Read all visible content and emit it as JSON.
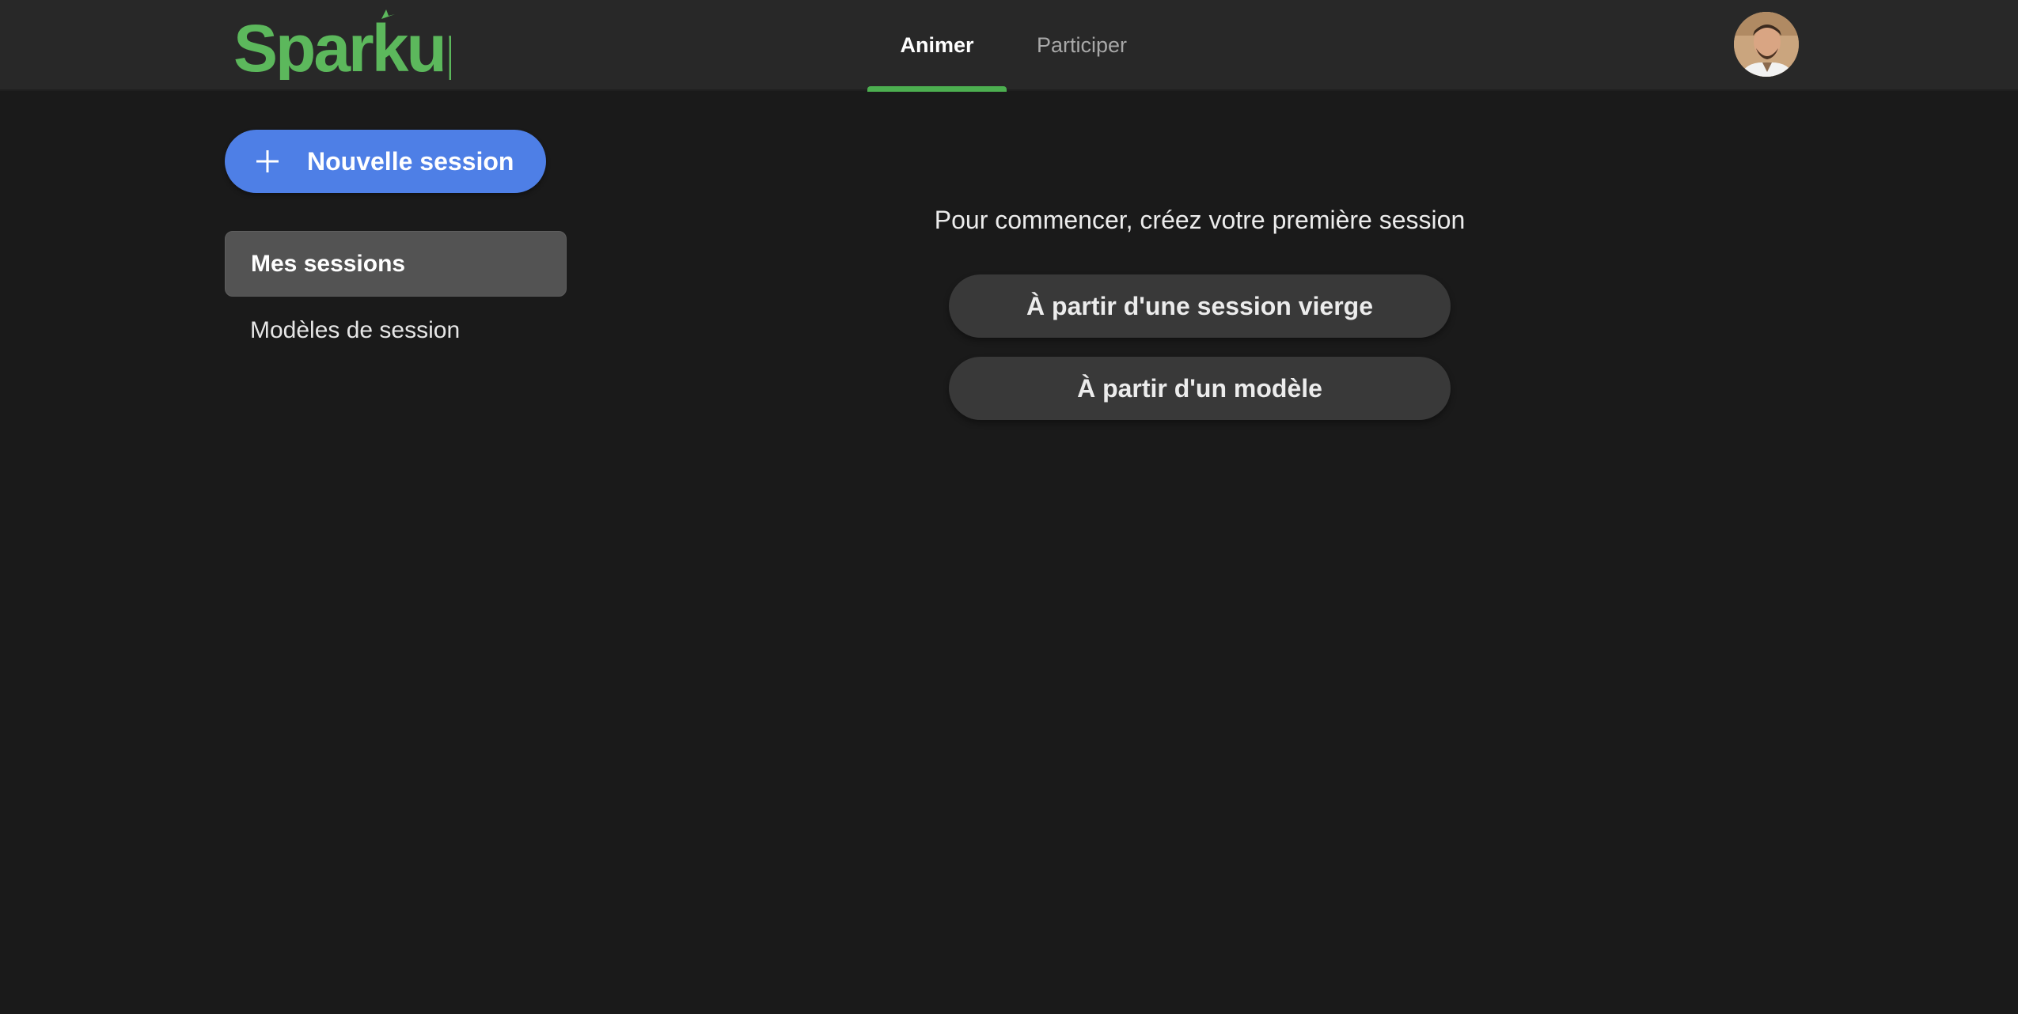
{
  "app": {
    "brand": "Sparkup",
    "brand_color": "#5cb85c"
  },
  "header": {
    "tabs": [
      {
        "label": "Animer",
        "active": true
      },
      {
        "label": "Participer",
        "active": false
      }
    ],
    "accent_color": "#4caf50",
    "avatar_icon": "user-avatar"
  },
  "sidebar": {
    "new_session_label": "Nouvelle session",
    "new_session_icon": "plus-icon",
    "new_session_color": "#4e7fe6",
    "items": [
      {
        "label": "Mes sessions",
        "active": true
      },
      {
        "label": "Modèles de session",
        "active": false
      }
    ]
  },
  "main": {
    "prompt": "Pour commencer, créez votre première session",
    "options": [
      {
        "label": "À partir d'une session vierge"
      },
      {
        "label": "À partir d'un modèle"
      }
    ]
  }
}
